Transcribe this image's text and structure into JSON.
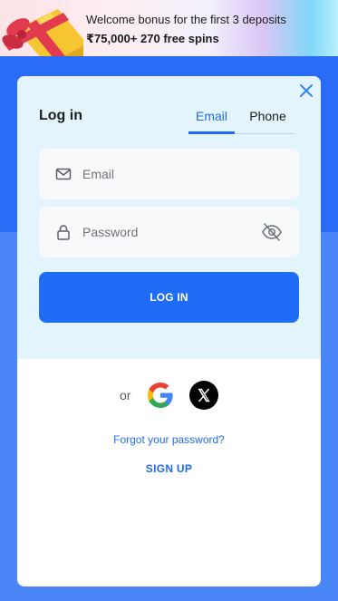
{
  "banner": {
    "line1": "Welcome bonus for the first 3 deposits",
    "line2": "₹75,000+ 270 free spins",
    "icon": "gift-icon"
  },
  "modal": {
    "title": "Log in",
    "close_icon": "close-icon",
    "tabs": [
      {
        "label": "Email",
        "active": true
      },
      {
        "label": "Phone",
        "active": false
      }
    ],
    "email_field": {
      "placeholder": "Email",
      "value": "",
      "icon": "mail-icon"
    },
    "password_field": {
      "placeholder": "Password",
      "value": "",
      "icon": "lock-icon",
      "toggle_icon": "eye-off-icon"
    },
    "login_button": "LOG IN",
    "or_text": "or",
    "social": [
      {
        "name": "Google",
        "icon": "google-icon"
      },
      {
        "name": "X",
        "icon": "x-icon"
      }
    ],
    "forgot_link": "Forgot your password?",
    "signup_link": "SIGN UP"
  },
  "colors": {
    "accent": "#1f6cf6",
    "page_bg_top": "#2a6cf6",
    "page_bg_bottom": "#4a86f7",
    "card_top_bg": "#e3f4fd",
    "field_bg": "#f8f9fb"
  }
}
